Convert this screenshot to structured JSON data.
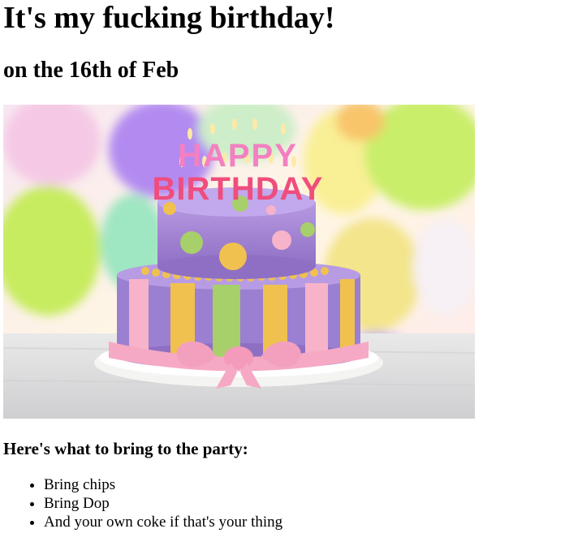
{
  "heading": "It's my fucking birthday!",
  "subheading": "on the 16th of Feb",
  "image": {
    "cake_text_top": "HAPPY",
    "cake_text_bottom": "BIRTHDAY"
  },
  "party": {
    "title": "Here's what to bring to the party:",
    "items": [
      "Bring chips",
      "Bring Dop",
      "And your own coke if that's your thing"
    ]
  },
  "colors": {
    "cake_purple": "#9b7fd0",
    "cake_yellow": "#f0c14f",
    "cake_green": "#a7cf6a",
    "cake_pink": "#f7b3c9",
    "balloon_green": "#c9ee6b",
    "balloon_purple": "#b38bf0"
  }
}
